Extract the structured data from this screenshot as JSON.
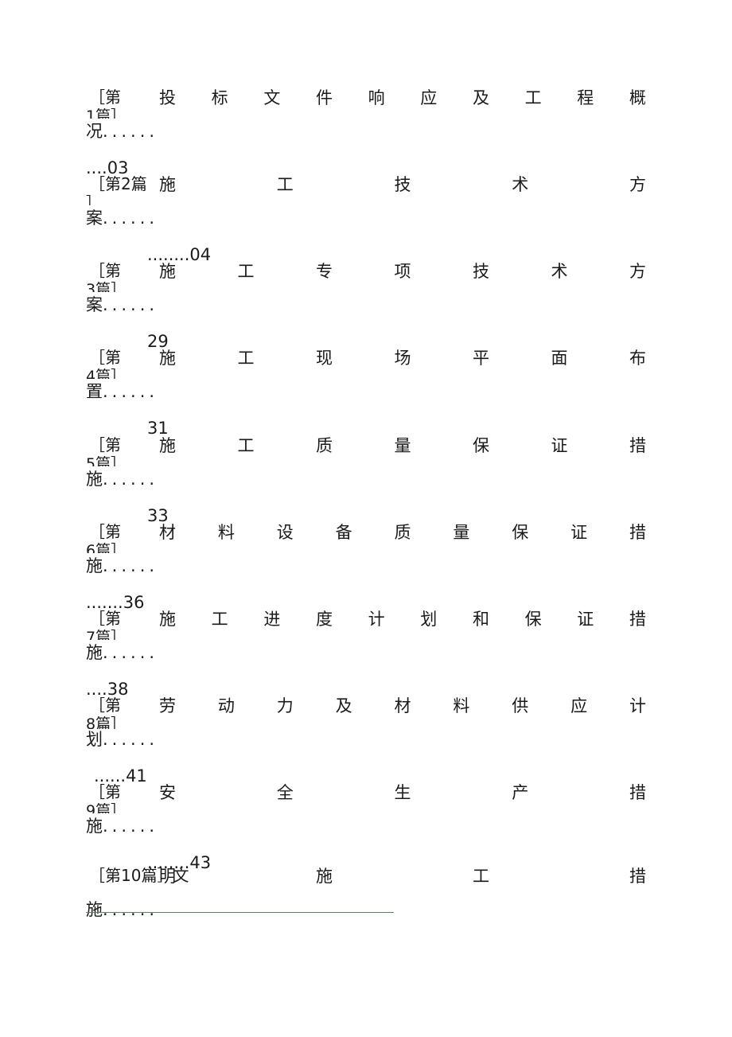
{
  "document": {
    "type": "table-of-contents",
    "language": "zh-CN",
    "bracket_open": "［",
    "bracket_close": "］",
    "leader_dots": "......",
    "rule_color": "#6b7a6b"
  },
  "entries": [
    {
      "marker_open": "［第",
      "marker_clip": "1篇］",
      "marker_full": "［第1篇］",
      "title_chars": [
        "投",
        "标",
        "文",
        "件",
        "响",
        "应",
        "及",
        "工",
        "程",
        "概"
      ],
      "tail_char": "况",
      "tail_dots": "......",
      "page_dots": "....",
      "page": "03",
      "page_indent": 108
    },
    {
      "marker_open": "［第2篇",
      "marker_clip": "］",
      "marker_full": "［第2篇］",
      "title_chars": [
        "施",
        "工",
        "技",
        "术",
        "方"
      ],
      "tail_char": "案",
      "tail_dots": "......",
      "page_dots": "........",
      "page": "04",
      "page_indent": 185
    },
    {
      "marker_open": "［第",
      "marker_clip": "3篇］",
      "marker_full": "［第3篇］",
      "title_chars": [
        "施",
        "工",
        "专",
        "项",
        "技",
        "术",
        "方"
      ],
      "tail_char": "案",
      "tail_dots": "......",
      "page_dots": "",
      "page": "29",
      "page_indent": 185
    },
    {
      "marker_open": "［第",
      "marker_clip": "4篇］",
      "marker_full": "［第4篇］",
      "title_chars": [
        "施",
        "工",
        "现",
        "场",
        "平",
        "面",
        "布"
      ],
      "tail_char": "置",
      "tail_dots": "......",
      "page_dots": "",
      "page": "31",
      "page_indent": 185
    },
    {
      "marker_open": "［第",
      "marker_clip": "5篇］",
      "marker_full": "［第5篇］",
      "title_chars": [
        "施",
        "工",
        "质",
        "量",
        "保",
        "证",
        "措"
      ],
      "tail_char": "施",
      "tail_dots": "......",
      "page_dots": "",
      "page": "33",
      "page_indent": 185
    },
    {
      "marker_open": "［第",
      "marker_clip": "6篇］",
      "marker_full": "［第6篇］",
      "title_chars": [
        "材",
        "料",
        "设",
        "备",
        "质",
        "量",
        "保",
        "证",
        "措"
      ],
      "tail_char": "施",
      "tail_dots": "......",
      "page_dots": ".......",
      "page": "36",
      "page_indent": 108
    },
    {
      "marker_open": "［第",
      "marker_clip": "7篇］",
      "marker_full": "［第7篇］",
      "title_chars": [
        "施",
        "工",
        "进",
        "度",
        "计",
        "划",
        "和",
        "保",
        "证",
        "措"
      ],
      "tail_char": "施",
      "tail_dots": "......",
      "page_dots": "....",
      "page": "38",
      "page_indent": 108
    },
    {
      "marker_open": "［第",
      "marker_clip": "8篇］",
      "marker_full": "［第8篇］",
      "title_chars": [
        "劳",
        "动",
        "力",
        "及",
        "材",
        "料",
        "供",
        "应",
        "计"
      ],
      "tail_char": "划",
      "tail_dots": "......",
      "page_dots": "......",
      "page": "41",
      "page_indent": 118
    },
    {
      "marker_open": "［第",
      "marker_clip": "9篇］",
      "marker_full": "［第9篇］",
      "title_chars": [
        "安",
        "全",
        "生",
        "产",
        "措"
      ],
      "tail_char": "施",
      "tail_dots": "......",
      "page_dots": "........",
      "page": "43",
      "page_indent": 185
    },
    {
      "marker_open": "［第10篇］文",
      "marker_clip": "",
      "marker_full": "［第10篇］文",
      "title_chars": [
        "明",
        "施",
        "工",
        "措"
      ],
      "tail_char": "施",
      "tail_dots": "......",
      "page_dots": "",
      "page": "",
      "page_indent": 108
    }
  ]
}
